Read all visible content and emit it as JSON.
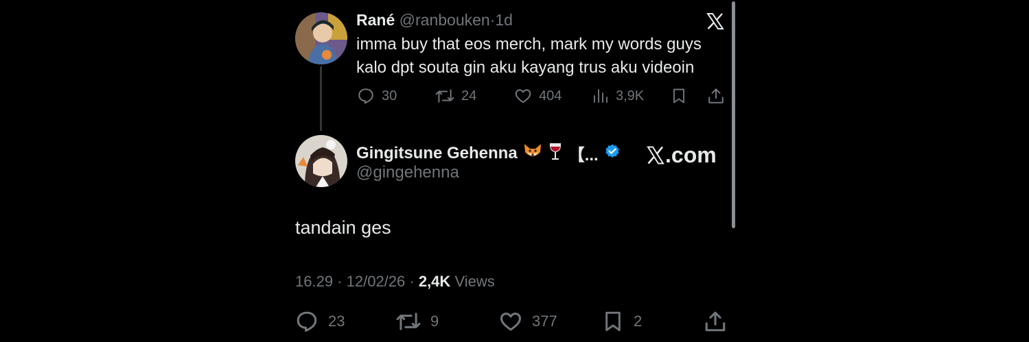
{
  "parent_tweet": {
    "display_name": "Rané",
    "handle": "@ranbouken",
    "time": "1d",
    "lines": [
      "imma buy that eos merch, mark my words guys",
      "kalo dpt souta gin aku kayang trus aku videoin"
    ],
    "replies": "30",
    "reposts": "24",
    "likes": "404",
    "views": "3,9K"
  },
  "main_tweet": {
    "display_name": "Gingitsune Gehenna",
    "name_suffix": "【...",
    "handle": "@gingehenna",
    "text": "tandain ges",
    "time": "16.29",
    "date": "12/02/26",
    "views_count": "2,4K",
    "views_label": "Views",
    "replies": "23",
    "reposts": "9",
    "likes": "377",
    "bookmarks": "2"
  },
  "branding": {
    "x_domain": ".com"
  },
  "icons": [
    "x-logo-icon",
    "reply-icon",
    "repost-icon",
    "like-icon",
    "views-icon",
    "bookmark-icon",
    "share-icon",
    "verified-badge-icon",
    "fox-emoji-icon",
    "wine-glass-icon"
  ],
  "colors": {
    "background": "#000000",
    "text": "#e7e9ea",
    "muted": "#71767b",
    "verified": "#1d9bf0"
  }
}
